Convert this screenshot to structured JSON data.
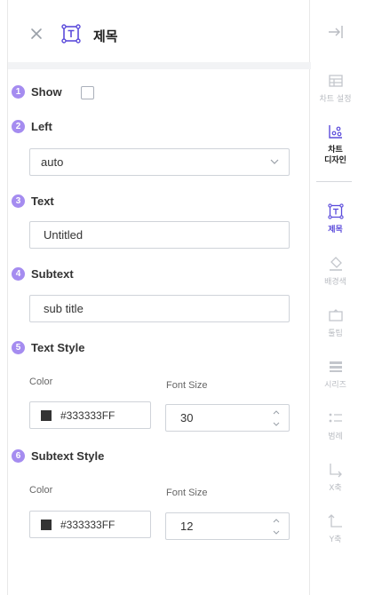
{
  "header": {
    "title": "제목",
    "close_icon": "close-icon",
    "title_icon": "title-box-icon"
  },
  "colors": {
    "accent": "#5b4bdb",
    "badge": "#a58cf0",
    "text_color_swatch": "#333333",
    "divider": "#f2f3f5"
  },
  "sections": {
    "show": {
      "number": "1",
      "label": "Show",
      "checked": false
    },
    "left": {
      "number": "2",
      "label": "Left",
      "value": "auto"
    },
    "text": {
      "number": "3",
      "label": "Text",
      "value": "Untitled"
    },
    "subtext": {
      "number": "4",
      "label": "Subtext",
      "value": "sub title"
    },
    "text_style": {
      "number": "5",
      "label": "Text Style",
      "color_label": "Color",
      "color_value": "#333333FF",
      "font_size_label": "Font Size",
      "font_size_value": "30"
    },
    "subtext_style": {
      "number": "6",
      "label": "Subtext Style",
      "color_label": "Color",
      "color_value": "#333333FF",
      "font_size_label": "Font Size",
      "font_size_value": "12"
    }
  },
  "rail": {
    "exit_icon": "panel-exit-icon",
    "items": [
      {
        "label": "차트 설정",
        "icon": "table-grid-icon"
      },
      {
        "label": "차트\n디자인",
        "icon": "chart-design-icon"
      },
      {
        "label": "제목",
        "icon": "title-box-icon"
      },
      {
        "label": "배경색",
        "icon": "paint-bucket-icon"
      },
      {
        "label": "툴팁",
        "icon": "tooltip-icon"
      },
      {
        "label": "시리즈",
        "icon": "series-icon"
      },
      {
        "label": "범례",
        "icon": "legend-icon"
      },
      {
        "label": "X축",
        "icon": "x-axis-icon"
      },
      {
        "label": "Y축",
        "icon": "y-axis-icon"
      }
    ]
  }
}
